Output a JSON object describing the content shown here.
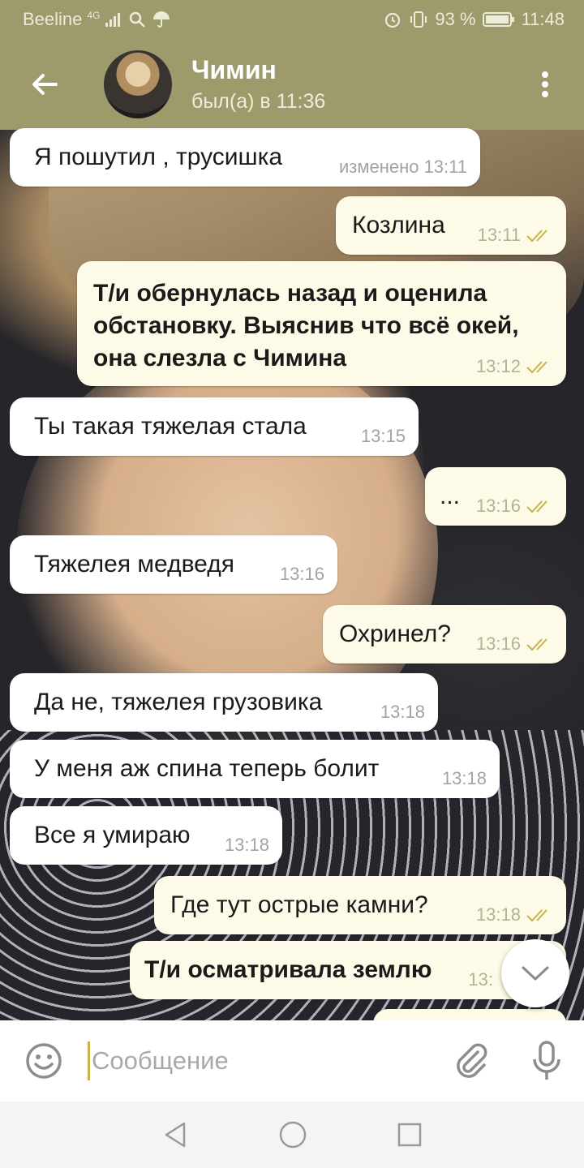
{
  "status_bar": {
    "carrier": "Beeline",
    "network": "4G",
    "battery": "93 %",
    "time": "11:48"
  },
  "header": {
    "contact_name": "Чимин",
    "last_seen": "был(а) в 11:36"
  },
  "messages": [
    {
      "dir": "in",
      "text": "Я пошутил , трусишка",
      "time": "изменено 13:11"
    },
    {
      "dir": "out",
      "text": "Козлина",
      "time": "13:11"
    },
    {
      "dir": "out",
      "text": "Т/и обернулась назад и оценила обстановку. Выяснив что всё окей, она слезла с Чимина",
      "time": "13:12",
      "bold": true
    },
    {
      "dir": "in",
      "text": "Ты такая тяжелая стала",
      "time": "13:15"
    },
    {
      "dir": "out",
      "text": "...",
      "time": "13:16"
    },
    {
      "dir": "in",
      "text": "Тяжелея медведя",
      "time": "13:16"
    },
    {
      "dir": "out",
      "text": "Охринел?",
      "time": "13:16"
    },
    {
      "dir": "in",
      "text": "Да не, тяжелея грузовика",
      "time": "13:18"
    },
    {
      "dir": "in",
      "text": "У меня аж спина теперь болит",
      "time": "13:18"
    },
    {
      "dir": "in",
      "text": "Все я умираю",
      "time": "13:18"
    },
    {
      "dir": "out",
      "text": "Где тут острые камни?",
      "time": "13:18"
    },
    {
      "dir": "out",
      "text": "Т/и осматривала землю",
      "time": "13:",
      "bold": true
    }
  ],
  "composer": {
    "placeholder": "Сообщение"
  },
  "colors": {
    "header": "#9d9a6c",
    "outgoing_bubble": "#fdfbe7",
    "incoming_bubble": "#ffffff",
    "read_check": "#c7b34a"
  }
}
